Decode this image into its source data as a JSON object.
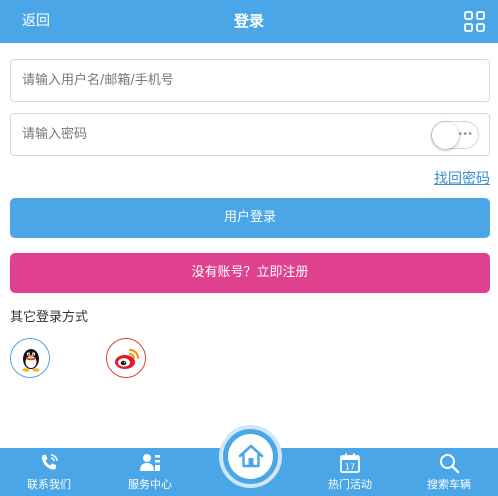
{
  "header": {
    "back_label": "返回",
    "title": "登录",
    "menu_icon": "grid-icon"
  },
  "form": {
    "username_placeholder": "请输入用户名/邮箱/手机号",
    "password_placeholder": "请输入密码",
    "show_password_toggle": "off",
    "forgot_label": "找回密码",
    "login_label": "用户登录",
    "register_label": "没有账号？立即注册"
  },
  "other_login": {
    "label": "其它登录方式",
    "providers": [
      "qq-icon",
      "weibo-icon"
    ]
  },
  "footer": {
    "tabs": [
      {
        "label": "联系我们",
        "icon": "phone-icon"
      },
      {
        "label": "服务中心",
        "icon": "service-icon"
      },
      {
        "label": "热门活动",
        "icon": "calendar-icon",
        "icon_text": "17"
      },
      {
        "label": "搜索车辆",
        "icon": "search-icon"
      }
    ],
    "home_icon": "home-icon"
  },
  "colors": {
    "primary": "#4aa6e6",
    "register": "#e0418e",
    "link": "#3b8fd1"
  }
}
